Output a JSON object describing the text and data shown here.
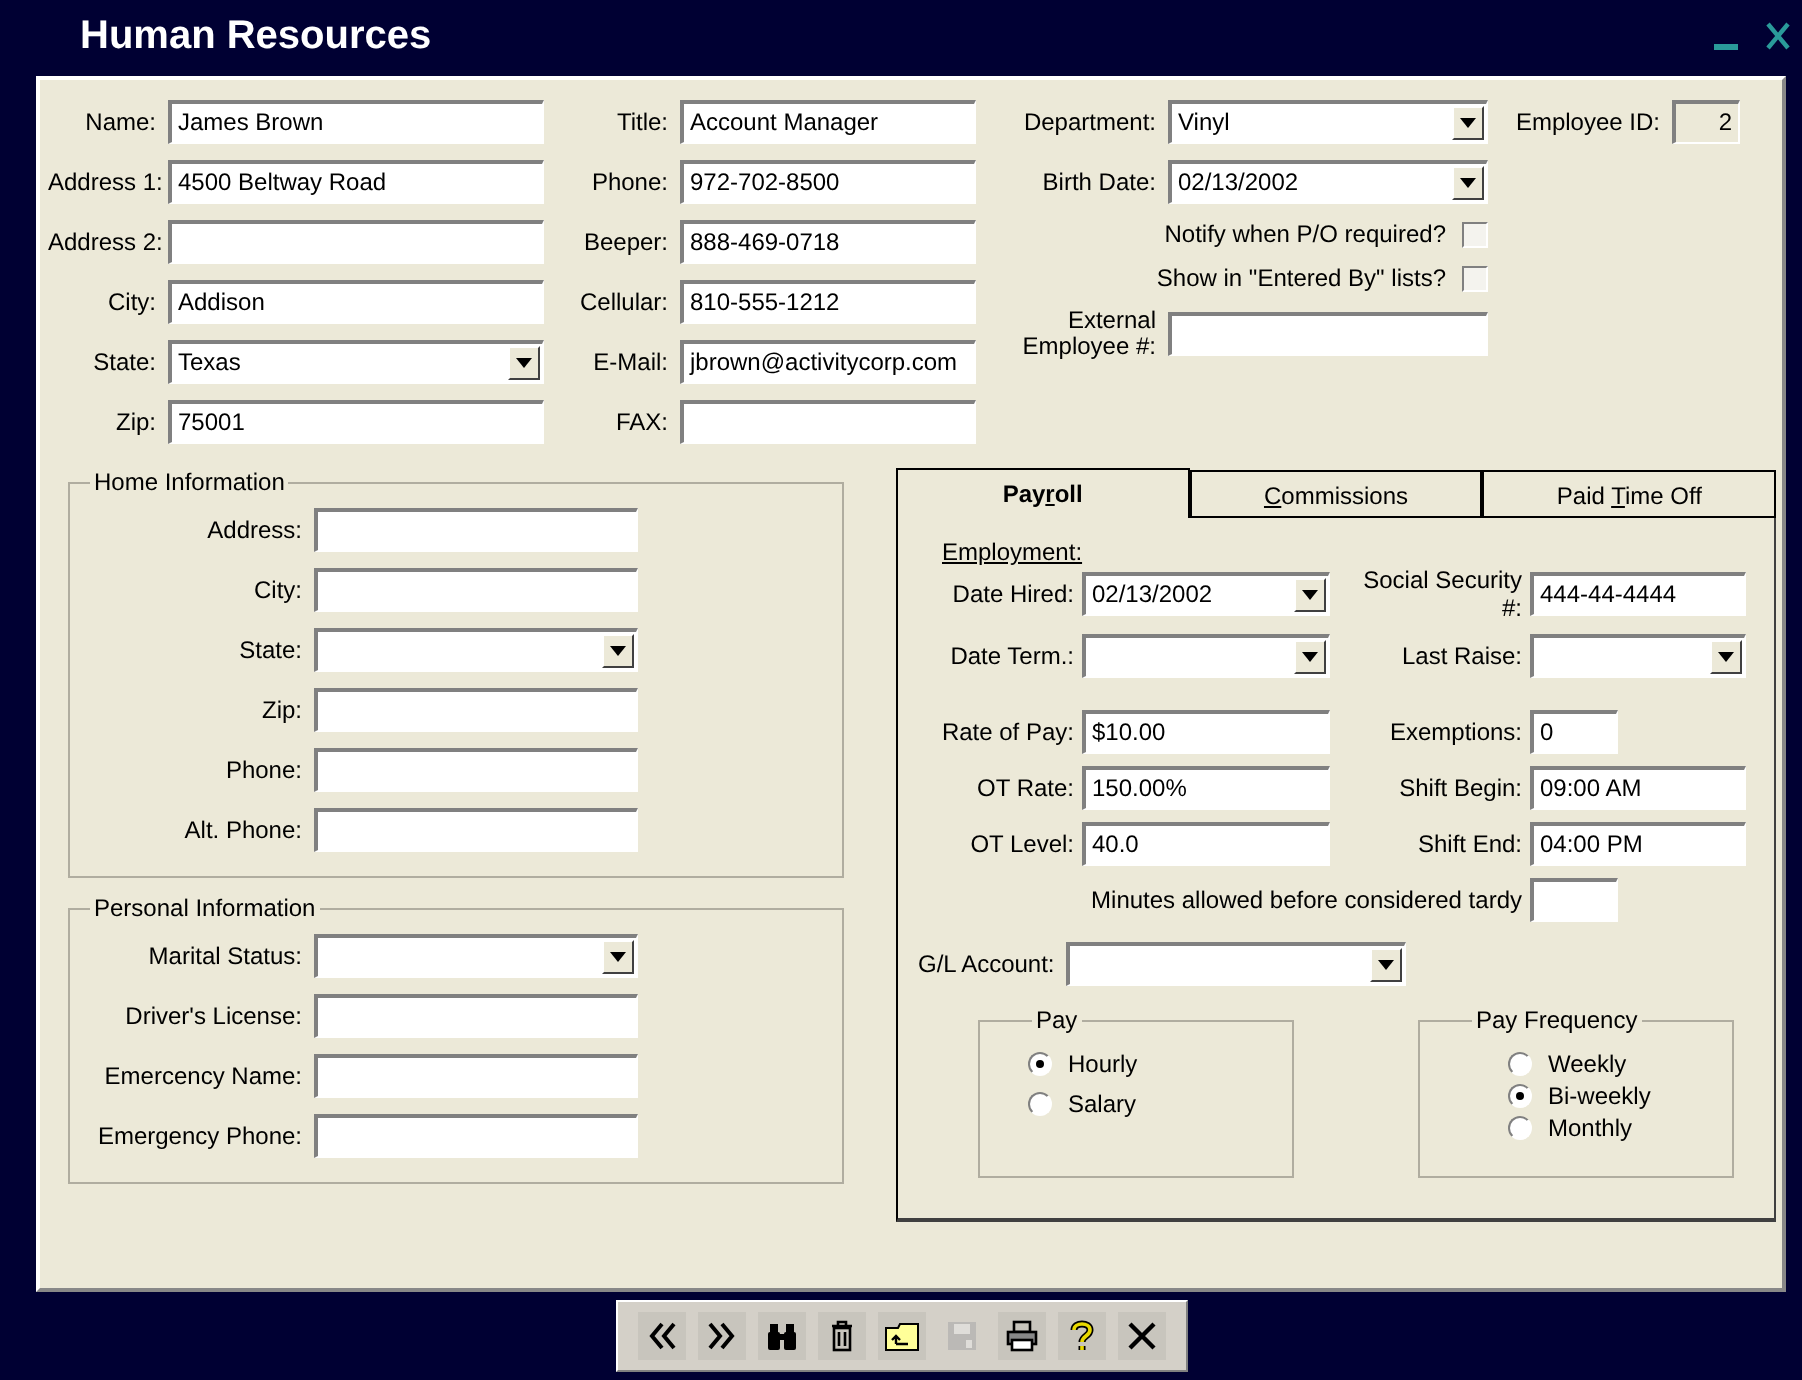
{
  "window": {
    "title": "Human Resources"
  },
  "contact": {
    "column_1": [
      {
        "label": "Name:",
        "value": "James Brown",
        "kind": "text"
      },
      {
        "label": "Address 1:",
        "value": "4500 Beltway Road",
        "kind": "text"
      },
      {
        "label": "Address 2:",
        "kind": "text"
      },
      {
        "label": "City:",
        "value": "Addison",
        "kind": "text"
      },
      {
        "label": "State:",
        "value": "Texas",
        "kind": "dropdown"
      },
      {
        "label": "Zip:",
        "value": "75001",
        "kind": "text"
      }
    ],
    "column_2": [
      {
        "label": "Title:",
        "value": "Account Manager",
        "kind": "text"
      },
      {
        "label": "Phone:",
        "value": "972-702-8500",
        "kind": "text"
      },
      {
        "label": "Beeper:",
        "value": "888-469-0718",
        "kind": "text"
      },
      {
        "label": "Cellular:",
        "value": "810-555-1212",
        "kind": "text"
      },
      {
        "label": "E-Mail:",
        "value": "jbrown@activitycorp.com",
        "kind": "text"
      },
      {
        "label": "FAX:",
        "kind": "text"
      }
    ],
    "department": {
      "label": "Department:",
      "value": "Vinyl",
      "kind": "dropdown"
    },
    "employee_id": {
      "label": "Employee ID:",
      "value": "2",
      "kind": "readonly"
    },
    "birth_date": {
      "label": "Birth Date:",
      "value": "02/13/2002",
      "kind": "dropdown"
    },
    "checkboxes": [
      {
        "label": "Notify when P/O required?",
        "checked": false
      },
      {
        "label": "Show in \"Entered By\" lists?",
        "checked": false
      }
    ],
    "external_employee": {
      "label": "External Employee #:",
      "kind": "text"
    }
  },
  "home_information": {
    "title": "Home Information",
    "fields": [
      {
        "label": "Address:",
        "kind": "text"
      },
      {
        "label": "City:",
        "kind": "text"
      },
      {
        "label": "State:",
        "kind": "dropdown"
      },
      {
        "label": "Zip:",
        "kind": "text"
      },
      {
        "label": "Phone:",
        "kind": "text"
      },
      {
        "label": "Alt. Phone:",
        "kind": "text"
      }
    ]
  },
  "personal_information": {
    "title": "Personal Information",
    "fields": [
      {
        "label": "Marital Status:",
        "kind": "dropdown"
      },
      {
        "label": "Driver's License:",
        "kind": "text"
      },
      {
        "label": "Emercency Name:",
        "kind": "text"
      },
      {
        "label": "Emergency Phone:",
        "kind": "text"
      }
    ]
  },
  "tabs": [
    {
      "label_before": "Pay",
      "access_key": "r",
      "label_after": "oll",
      "selected": true
    },
    {
      "access_key": "C",
      "label_after": "ommissions",
      "selected": false
    },
    {
      "label_before": "Paid ",
      "access_key": "T",
      "label_after": "ime Off",
      "selected": false
    }
  ],
  "payroll": {
    "heading": "Employment:",
    "rows": [
      {
        "left": {
          "label": "Date Hired:",
          "value": "02/13/2002",
          "kind": "dropdown"
        },
        "right": {
          "label": "Social Security #:",
          "value": "444-44-4444",
          "kind": "text"
        }
      },
      {
        "left": {
          "label": "Date Term.:",
          "kind": "dropdown"
        },
        "right": {
          "label": "Last Raise:",
          "kind": "dropdown"
        }
      },
      {
        "left": {
          "label": "Rate of Pay:",
          "value": "$10.00",
          "kind": "text"
        },
        "right": {
          "label": "Exemptions:",
          "value": "0",
          "kind": "short"
        }
      },
      {
        "left": {
          "label": "OT Rate:",
          "value": "150.00%",
          "kind": "text"
        },
        "right": {
          "label": "Shift Begin:",
          "value": "09:00 AM",
          "kind": "text"
        }
      },
      {
        "left": {
          "label": "OT Level:",
          "value": "40.0",
          "kind": "text"
        },
        "right": {
          "label": "Shift End:",
          "value": "04:00 PM",
          "kind": "text"
        }
      }
    ],
    "tardy": {
      "label": "Minutes allowed before considered tardy",
      "kind": "short"
    },
    "gl_account": {
      "label": "G/L Account:",
      "kind": "dropdown"
    },
    "pay": {
      "title": "Pay",
      "options": [
        {
          "label": "Hourly",
          "selected": true
        },
        {
          "label": "Salary",
          "selected": false
        }
      ]
    },
    "pay_frequency": {
      "title": "Pay Frequency",
      "options": [
        {
          "label": "Weekly",
          "selected": false
        },
        {
          "label": "Bi-weekly",
          "selected": true
        },
        {
          "label": "Monthly",
          "selected": false
        }
      ]
    }
  },
  "toolbar": [
    {
      "kind": "previous",
      "disabled": false
    },
    {
      "kind": "next",
      "disabled": false
    },
    {
      "kind": "find",
      "disabled": false
    },
    {
      "kind": "delete",
      "disabled": false
    },
    {
      "kind": "open",
      "disabled": false
    },
    {
      "kind": "save",
      "disabled": true
    },
    {
      "kind": "print",
      "disabled": false
    },
    {
      "kind": "help",
      "disabled": false
    },
    {
      "kind": "close",
      "disabled": false
    }
  ]
}
